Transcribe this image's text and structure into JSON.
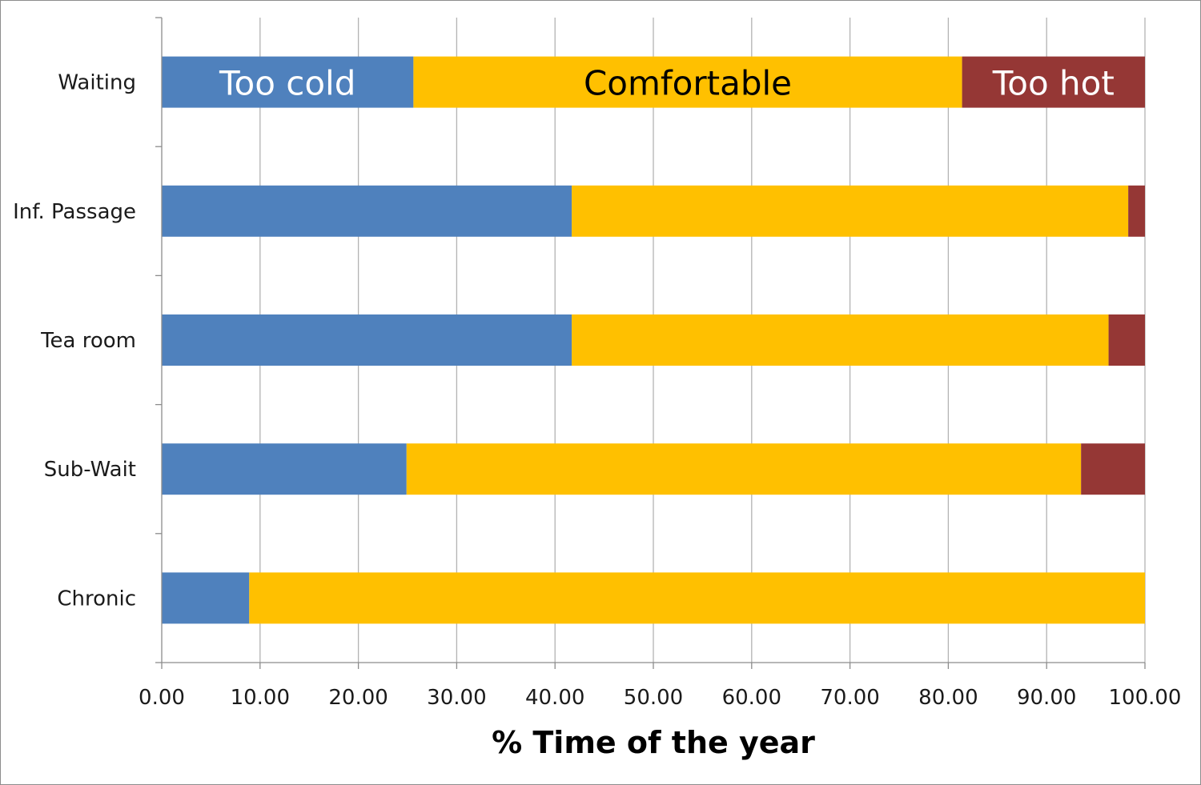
{
  "chart_data": {
    "type": "bar",
    "orientation": "horizontal",
    "stacked": true,
    "title": "",
    "xlabel": "% Time of the year",
    "ylabel": "",
    "xlim": [
      0,
      100
    ],
    "xticks": [
      0,
      10,
      20,
      30,
      40,
      50,
      60,
      70,
      80,
      90,
      100
    ],
    "xtick_labels": [
      "0.00",
      "10.00",
      "20.00",
      "30.00",
      "40.00",
      "50.00",
      "60.00",
      "70.00",
      "80.00",
      "90.00",
      "100.00"
    ],
    "grid": "vertical",
    "legend": "none",
    "categories": [
      "Waiting",
      "Inf. Passage",
      "Tea room",
      "Sub-Wait",
      "Chronic"
    ],
    "series": [
      {
        "name": "Too cold",
        "color": "#4f81bd",
        "values": [
          25.6,
          41.7,
          41.7,
          24.9,
          8.9
        ]
      },
      {
        "name": "Comfortable",
        "color": "#ffc000",
        "values": [
          55.8,
          56.6,
          54.6,
          68.6,
          91.1
        ]
      },
      {
        "name": "Too hot",
        "color": "#953735",
        "values": [
          18.6,
          1.7,
          3.7,
          6.5,
          0.0
        ]
      }
    ],
    "annotations": [
      {
        "text": "Too cold",
        "category": "Waiting",
        "series": "Too cold",
        "color": "#ffffff"
      },
      {
        "text": "Comfortable",
        "category": "Waiting",
        "series": "Comfortable",
        "color": "#000000"
      },
      {
        "text": "Too hot",
        "category": "Waiting",
        "series": "Too hot",
        "color": "#ffffff"
      }
    ]
  }
}
